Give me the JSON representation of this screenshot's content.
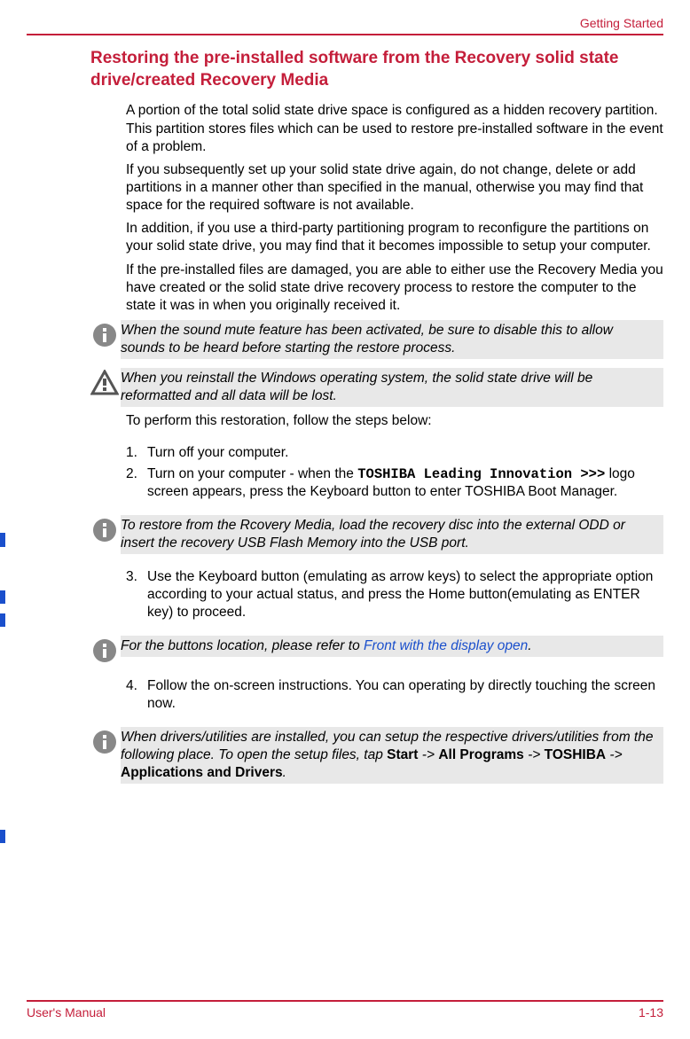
{
  "header": {
    "chapter": "Getting Started"
  },
  "section_title": "Restoring the pre-installed software from the Recovery solid state drive/created Recovery Media",
  "paras": {
    "p1": "A portion of the total solid state drive space is configured as a hidden recovery partition. This partition stores files which can be used to restore pre-installed software in the event of a problem.",
    "p2": "If you subsequently set up your solid state drive again, do not change, delete or add partitions in a manner other than specified in the manual, otherwise you may find that space for the required software is not available.",
    "p3": "In addition, if you use a third-party partitioning program to reconfigure the partitions on your solid state drive, you may find that it becomes impossible to setup your computer.",
    "p4": "If the pre-installed files are damaged, you are able to either use the Recovery Media you have created or the solid state drive recovery process to restore the computer to the state it was in when you originally received it."
  },
  "callouts": {
    "c1": "When the sound mute feature has been activated, be sure to disable this to allow sounds to be heard before starting the restore process.",
    "c2": "When you reinstall the Windows operating system, the solid state drive will be reformatted and all data will be lost.",
    "c3": "To restore from the Rcovery Media, load the recovery disc into the external ODD or insert the recovery USB Flash Memory into the USB port.",
    "c4_pre": "For the buttons location, please refer to ",
    "c4_link": "Front with the display open",
    "c4_post": ".",
    "c5_pre": "When drivers/utilities are installed, you can setup the respective drivers/utilities from the following place. To open the setup files, tap ",
    "c5_b1": "Start",
    "c5_s1": " -> ",
    "c5_b2": "All Programs",
    "c5_s2": " -> ",
    "c5_b3": "TOSHIBA",
    "c5_s3": " -> ",
    "c5_b4": "Applications and Drivers",
    "c5_post": "."
  },
  "intro_steps": "To perform this restoration, follow the steps below:",
  "steps": {
    "s1_num": "1.",
    "s1": "Turn off your computer.",
    "s2_num": "2.",
    "s2_pre": "Turn on your computer - when the ",
    "s2_mono": "TOSHIBA Leading Innovation >>>",
    "s2_post": " logo screen appears, press the Keyboard button to enter TOSHIBA Boot Manager.",
    "s3_num": "3.",
    "s3": "Use the Keyboard button (emulating as arrow keys) to select the appropriate option according to your actual status, and press the Home button(emulating as ENTER key) to proceed.",
    "s4_num": "4.",
    "s4": "Follow the on-screen instructions. You can operating by directly touching the screen now."
  },
  "footer": {
    "left": "User's Manual",
    "right": "1-13"
  },
  "icons": {
    "info": "info-icon",
    "caution": "caution-icon"
  }
}
